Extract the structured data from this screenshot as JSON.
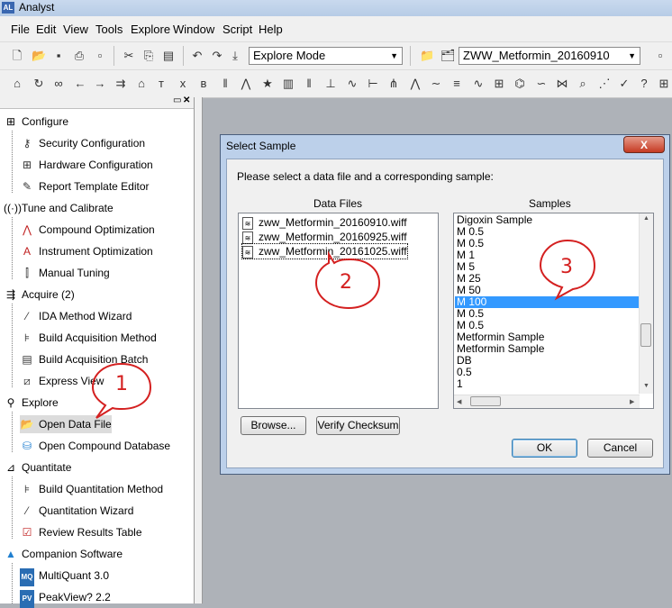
{
  "app": {
    "title": "Analyst",
    "icon_text": "AL"
  },
  "menu": [
    "File",
    "Edit",
    "View",
    "Tools",
    "Explore",
    "Window",
    "Script",
    "Help"
  ],
  "toolbar": {
    "mode_value": "Explore Mode",
    "project_value": "ZWW_Metformin_20160910"
  },
  "nav": {
    "configure": {
      "label": "Configure",
      "items": [
        "Security Configuration",
        "Hardware Configuration",
        "Report Template Editor"
      ]
    },
    "tune": {
      "label": "Tune and Calibrate",
      "items": [
        "Compound Optimization",
        "Instrument Optimization",
        "Manual Tuning"
      ]
    },
    "acquire": {
      "label": "Acquire",
      "count": "(2)",
      "items": [
        "IDA Method Wizard",
        "Build Acquisition Method",
        "Build Acquisition Batch",
        "Express View"
      ]
    },
    "explore": {
      "label": "Explore",
      "items": [
        "Open Data File",
        "Open Compound Database"
      ]
    },
    "quantitate": {
      "label": "Quantitate",
      "items": [
        "Build Quantitation Method",
        "Quantitation Wizard",
        "Review Results Table"
      ]
    },
    "companion": {
      "label": "Companion Software",
      "items": [
        "MultiQuant 3.0",
        "PeakView? 2.2"
      ]
    }
  },
  "dialog": {
    "title": "Select Sample",
    "close_label": "X",
    "prompt": "Please select a data file and a corresponding sample:",
    "data_files_header": "Data Files",
    "samples_header": "Samples",
    "files": [
      "zww_Metformin_20160910.wiff",
      "zww_Metformin_20160925.wiff",
      "zww_Metformin_20161025.wiff"
    ],
    "selected_file_index": 2,
    "samples": [
      "Digoxin Sample",
      "M 0.5",
      "M 0.5",
      "M 1",
      "M 5",
      "M 25",
      "M 50",
      "M 100",
      "M 0.5",
      "M 0.5",
      "Metformin Sample",
      "Metformin Sample",
      "DB",
      "0.5",
      "1"
    ],
    "selected_sample_index": 7,
    "browse_label": "Browse...",
    "verify_label": "Verify Checksum",
    "ok_label": "OK",
    "cancel_label": "Cancel"
  },
  "callouts": [
    "1",
    "2",
    "3"
  ],
  "colors": {
    "selection": "#3399ff",
    "callout": "#d42020",
    "dialog_frame": "#bcd0ea"
  }
}
